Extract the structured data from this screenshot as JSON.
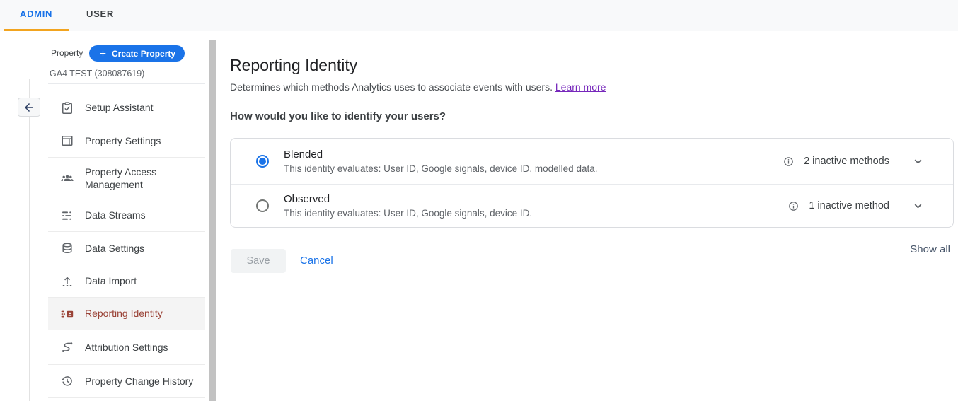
{
  "header": {
    "tabs": [
      {
        "label": "ADMIN",
        "active": true
      },
      {
        "label": "USER",
        "active": false
      }
    ]
  },
  "sidebar": {
    "column_label": "Property",
    "create_property_button": "Create Property",
    "property_name": "GA4 TEST (308087619)",
    "items": [
      {
        "label": "Setup Assistant",
        "icon": "clipboard-check-icon",
        "selected": false
      },
      {
        "label": "Property Settings",
        "icon": "window-layout-icon",
        "selected": false
      },
      {
        "label": "Property Access Management",
        "icon": "people-icon",
        "selected": false
      },
      {
        "label": "Data Streams",
        "icon": "stream-list-icon",
        "selected": false
      },
      {
        "label": "Data Settings",
        "icon": "database-icon",
        "selected": false
      },
      {
        "label": "Data Import",
        "icon": "upload-icon",
        "selected": false
      },
      {
        "label": "Reporting Identity",
        "icon": "identity-card-icon",
        "selected": true
      },
      {
        "label": "Attribution Settings",
        "icon": "route-icon",
        "selected": false
      },
      {
        "label": "Property Change History",
        "icon": "history-icon",
        "selected": false
      }
    ]
  },
  "main": {
    "title": "Reporting Identity",
    "description": "Determines which methods Analytics uses to associate events with users.",
    "learn_more_label": "Learn more",
    "question": "How would you like to identify your users?",
    "options": [
      {
        "title": "Blended",
        "description": "This identity evaluates: User ID, Google signals, device ID, modelled data.",
        "inactive_label": "2 inactive methods",
        "selected": true
      },
      {
        "title": "Observed",
        "description": "This identity evaluates: User ID, Google signals, device ID.",
        "inactive_label": "1 inactive method",
        "selected": false
      }
    ],
    "save_label": "Save",
    "cancel_label": "Cancel",
    "show_all_label": "Show all"
  },
  "colors": {
    "accent_blue": "#1a73e8",
    "tab_underline_orange": "#f2a41f",
    "selected_item_red": "#9a4236",
    "link_purple": "#7627bb",
    "icon_gray": "#5f6368",
    "back_arrow_navy": "#2d3f63"
  }
}
